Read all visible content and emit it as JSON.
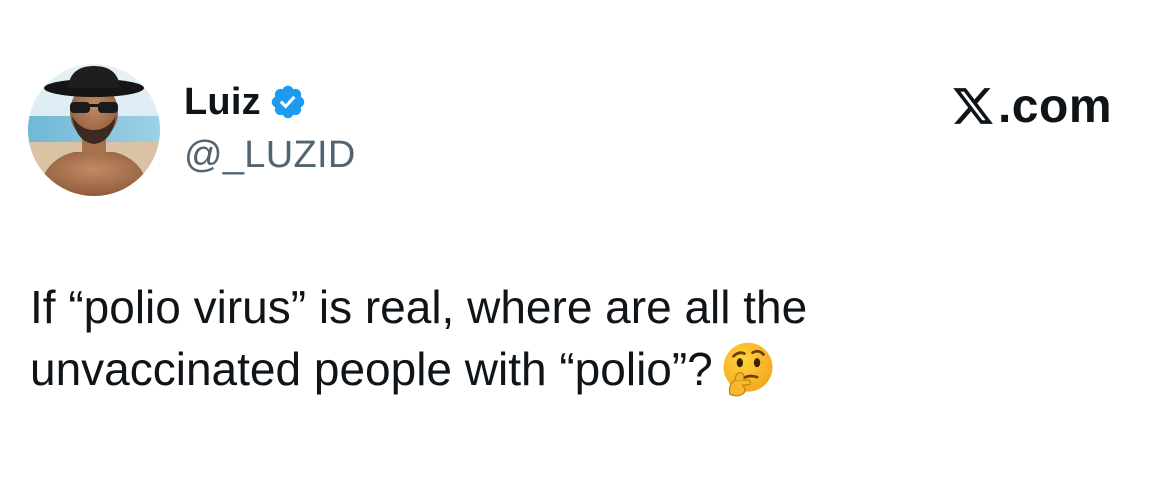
{
  "author": {
    "display_name": "Luiz",
    "handle": "@_LUZID",
    "verified": true,
    "avatar_icon": "profile-photo"
  },
  "brand": {
    "watermark_suffix": ".com",
    "logo_icon": "x-logo-icon"
  },
  "tweet": {
    "line1": "If “polio virus” is real, where are all the",
    "line2": "unvaccinated people with “polio”?",
    "emoji_icon": "thinking-face-icon"
  },
  "colors": {
    "text_primary": "#0f1419",
    "text_secondary": "#536471",
    "verified_blue": "#1d9bf0",
    "background": "#ffffff"
  }
}
